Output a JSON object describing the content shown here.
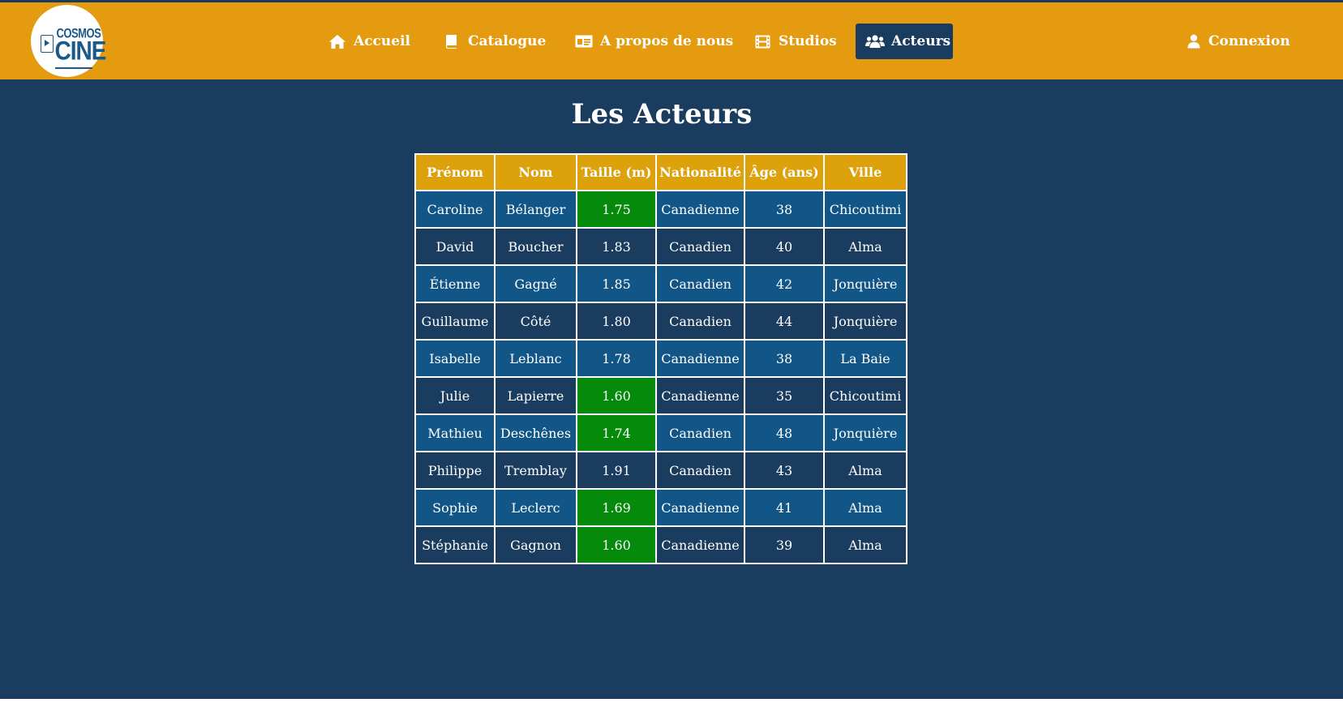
{
  "brand": {
    "logo_top": "COSMOS",
    "logo_bottom": "CINE"
  },
  "nav": {
    "items": [
      {
        "label": "Accueil",
        "icon": "home-icon",
        "active": false
      },
      {
        "label": "Catalogue",
        "icon": "book-icon",
        "active": false
      },
      {
        "label": "A propos de nous",
        "icon": "id-card-icon",
        "active": false
      },
      {
        "label": "Studios",
        "icon": "film-icon",
        "active": false
      },
      {
        "label": "Acteurs",
        "icon": "users-icon",
        "active": true
      }
    ],
    "login": {
      "label": "Connexion",
      "icon": "user-icon"
    }
  },
  "page": {
    "title": "Les Acteurs"
  },
  "table": {
    "headers": [
      "Prénom",
      "Nom",
      "Taille (m)",
      "Nationalité",
      "Âge (ans)",
      "Ville"
    ],
    "highlight_color": "#058a0b",
    "rows": [
      {
        "prenom": "Caroline",
        "nom": "Bélanger",
        "taille": "1.75",
        "nationalite": "Canadienne",
        "age": "38",
        "ville": "Chicoutimi",
        "highlight": true
      },
      {
        "prenom": "David",
        "nom": "Boucher",
        "taille": "1.83",
        "nationalite": "Canadien",
        "age": "40",
        "ville": "Alma",
        "highlight": false
      },
      {
        "prenom": "Étienne",
        "nom": "Gagné",
        "taille": "1.85",
        "nationalite": "Canadien",
        "age": "42",
        "ville": "Jonquière",
        "highlight": false
      },
      {
        "prenom": "Guillaume",
        "nom": "Côté",
        "taille": "1.80",
        "nationalite": "Canadien",
        "age": "44",
        "ville": "Jonquière",
        "highlight": false
      },
      {
        "prenom": "Isabelle",
        "nom": "Leblanc",
        "taille": "1.78",
        "nationalite": "Canadienne",
        "age": "38",
        "ville": "La Baie",
        "highlight": false
      },
      {
        "prenom": "Julie",
        "nom": "Lapierre",
        "taille": "1.60",
        "nationalite": "Canadienne",
        "age": "35",
        "ville": "Chicoutimi",
        "highlight": true
      },
      {
        "prenom": "Mathieu",
        "nom": "Deschênes",
        "taille": "1.74",
        "nationalite": "Canadien",
        "age": "48",
        "ville": "Jonquière",
        "highlight": true
      },
      {
        "prenom": "Philippe",
        "nom": "Tremblay",
        "taille": "1.91",
        "nationalite": "Canadien",
        "age": "43",
        "ville": "Alma",
        "highlight": false
      },
      {
        "prenom": "Sophie",
        "nom": "Leclerc",
        "taille": "1.69",
        "nationalite": "Canadienne",
        "age": "41",
        "ville": "Alma",
        "highlight": true
      },
      {
        "prenom": "Stéphanie",
        "nom": "Gagnon",
        "taille": "1.60",
        "nationalite": "Canadienne",
        "age": "39",
        "ville": "Alma",
        "highlight": true
      }
    ]
  }
}
